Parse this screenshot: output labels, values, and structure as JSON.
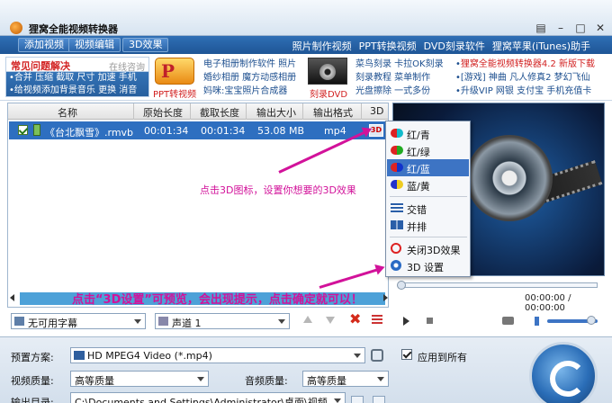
{
  "app": {
    "title": "狸窝全能视频转换器",
    "window_buttons": [
      "▤",
      "–",
      "□",
      "✕"
    ]
  },
  "menubar": {
    "tabs": [
      "添加视频",
      "视频编辑",
      "3D效果"
    ],
    "links": [
      "照片制作视频",
      "PPT转换视频",
      "DVD刻录软件",
      "狸窝苹果(iTunes)助手"
    ]
  },
  "ad": {
    "faq_title": "常见问题解决",
    "faq_online": "在线咨询",
    "faq_lines": [
      "•合并 压缩 截取 尺寸 加速 手机",
      "•给视频添加背景音乐 更换 消音"
    ],
    "ppt_caption": "PPT转视频",
    "col1": [
      "电子相册制作软件 照片",
      "婚纱相册 魔方动感相册",
      "妈咪:宝宝照片合成器"
    ],
    "dvd_caption": "刻录DVD",
    "col2": [
      "菜鸟刻录 卡拉OK刻录",
      "刻录教程 菜单制作",
      "光盘擦除 一式多份"
    ],
    "right_lines": [
      {
        "prefix": "•",
        "text": "狸窝全能视频转换器4.2 新版下载",
        "hot": true
      },
      {
        "prefix": "•",
        "text": "[游戏] 神曲 凡人修真2 梦幻飞仙",
        "hot": false
      },
      {
        "prefix": "•",
        "text": "升级VIP 网银 支付宝 手机充值卡",
        "hot": false
      }
    ]
  },
  "list": {
    "columns": [
      "名称",
      "原始长度",
      "截取长度",
      "输出大小",
      "输出格式",
      "3D"
    ],
    "rows": [
      {
        "name": "《台北飘雪》.rmvb",
        "orig_len": "00:01:34",
        "cut_len": "00:01:34",
        "size": "53.08 MB",
        "format": "mp4"
      }
    ]
  },
  "context_menu": {
    "items": [
      "红/青",
      "红/绿",
      "红/蓝",
      "蓝/黄",
      "交错",
      "并排",
      "关闭3D效果",
      "3D 设置"
    ],
    "active_index": 2
  },
  "annotations": {
    "note1": "点击3D图标，设置你想要的3D效果",
    "note2": "点击“3D设置”可预览，会出现提示，点击确定就可以！"
  },
  "player": {
    "time": "00:00:00 / 00:00:00",
    "volume": 0.8
  },
  "toolbar": {
    "subtitle": "无可用字幕",
    "audio_track": "声道 1"
  },
  "settings": {
    "preset_label": "预置方案:",
    "preset_value": "HD MPEG4 Video (*.mp4)",
    "apply_all": "应用到所有",
    "video_quality_label": "视频质量:",
    "video_quality_value": "高等质量",
    "audio_quality_label": "音频质量:",
    "audio_quality_value": "高等质量",
    "output_label": "输出目录:",
    "output_value": "C:\\Documents and Settings\\Administrator\\桌面\\视频"
  },
  "colors": {
    "menubar": "#2f6fb5",
    "selected_row": "#2e6fc0",
    "annotation": "#d2129a",
    "hot": "#d22222"
  }
}
